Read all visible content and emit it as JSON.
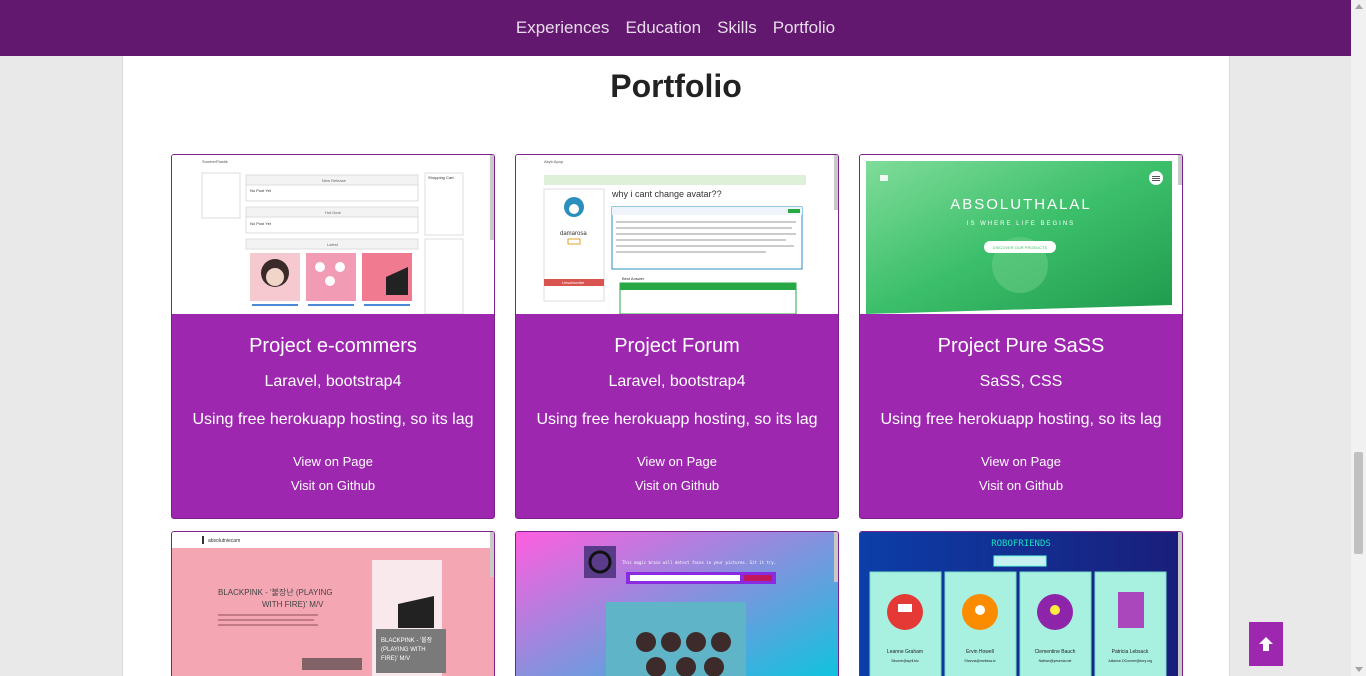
{
  "nav": {
    "items": [
      "Experiences",
      "Education",
      "Skills",
      "Portfolio"
    ]
  },
  "section": {
    "title": "Portfolio"
  },
  "projects": [
    {
      "title": "Project e-commers",
      "tech": "Laravel, bootstrap4",
      "note": "Using free herokuapp hosting, so its lag",
      "view_label": "View on Page",
      "github_label": "Visit on Github",
      "thumb": {
        "brand": "SumberPlastik",
        "panels": [
          "New Release",
          "Hot Deal",
          "Latest"
        ],
        "empty": "No Post Yet",
        "sidebar": [
          "Shopping Cart"
        ]
      }
    },
    {
      "title": "Project Forum",
      "tech": "Laravel, bootstrap4",
      "note": "Using free herokuapp hosting, so its lag",
      "view_label": "View on Page",
      "github_label": "Visit on Github",
      "thumb": {
        "brand": "Akyb Apop",
        "heading": "why i cant change avatar??",
        "user": "damarosa",
        "unsubscribe": "Unsubscribe",
        "best_answer": "Best Answer"
      }
    },
    {
      "title": "Project Pure SaSS",
      "tech": "SaSS, CSS",
      "note": "Using free herokuapp hosting, so its lag",
      "view_label": "View on Page",
      "github_label": "Visit on Github",
      "thumb": {
        "headline": "ABSOLUTHALAL",
        "tagline": "IS WHERE LIFE BEGINS",
        "button": "DISCOVER OUR PRODUCTS"
      }
    },
    {
      "thumb": {
        "brand": "absolutniecam",
        "headline": "BLACKPINK - '불장난 (PLAYING WITH FIRE)' M/V",
        "card": "BLACKPINK - '불장난 (PLAYING WITH FIRE)' M/V"
      }
    },
    {
      "thumb": {
        "caption": "This magic brain will detect faces in your pictures. Git it try."
      }
    },
    {
      "thumb": {
        "brand": "ROBOFRIENDS",
        "robots": [
          {
            "name": "Leanne Graham",
            "email": "Sincere@april.biz",
            "color": "#e53935"
          },
          {
            "name": "Ervin Howell",
            "email": "Shanna@melissa.tv",
            "color": "#fb8c00"
          },
          {
            "name": "Clementine Bauch",
            "email": "Nathan@yesenia.net",
            "color": "#8e24aa"
          },
          {
            "name": "Patricia Lebsack",
            "email": "Julianne.OConner@kory.org",
            "color": "#ab47bc"
          }
        ]
      }
    }
  ],
  "colors": {
    "navbar": "#62186f",
    "card": "#9e27b0",
    "to_top": "#9e27b0"
  },
  "icons": {
    "to_top": "arrow-up-icon"
  }
}
